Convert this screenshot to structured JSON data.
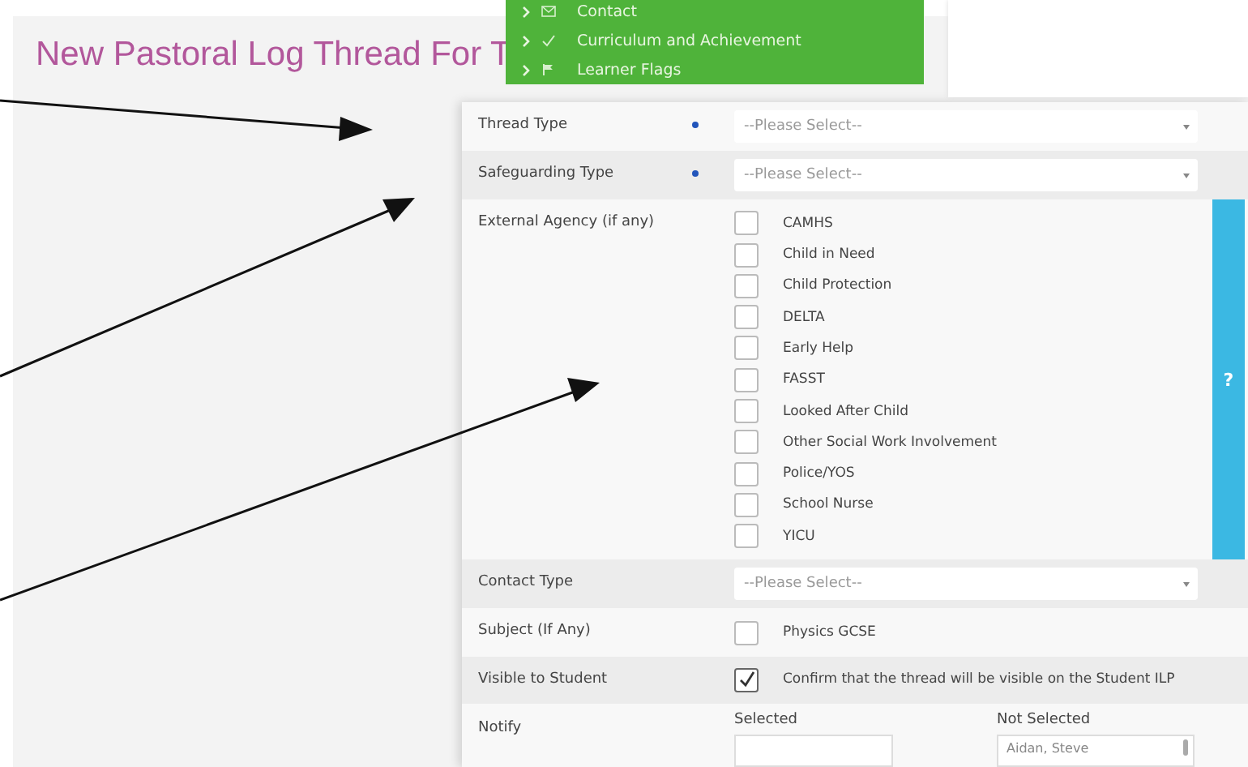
{
  "page_title": "New Pastoral Log Thread For T",
  "menu": {
    "items": [
      {
        "kind": "envelope",
        "label": "Contact"
      },
      {
        "kind": "check",
        "label": "Curriculum and Achievement"
      },
      {
        "kind": "flag",
        "label": "Learner Flags"
      }
    ]
  },
  "form": {
    "rows": [
      {
        "kind": "select",
        "label": "Thread Type",
        "required": true,
        "placeholder": "--Please Select--"
      },
      {
        "kind": "select",
        "label": "Safeguarding Type",
        "required": true,
        "placeholder": "--Please Select--"
      },
      {
        "kind": "checklist",
        "label": "External Agency (if any)",
        "options": [
          {
            "label": "CAMHS",
            "checked": false
          },
          {
            "label": "Child in Need",
            "checked": false
          },
          {
            "label": "Child Protection",
            "checked": false
          },
          {
            "label": "DELTA",
            "checked": false
          },
          {
            "label": "Early Help",
            "checked": false
          },
          {
            "label": "FASST",
            "checked": false
          },
          {
            "label": "Looked After Child",
            "checked": false
          },
          {
            "label": "Other Social Work Involvement",
            "checked": false
          },
          {
            "label": "Police/YOS",
            "checked": false
          },
          {
            "label": "School Nurse",
            "checked": false
          },
          {
            "label": "YICU",
            "checked": false
          }
        ]
      },
      {
        "kind": "select",
        "label": "Contact Type",
        "required": false,
        "placeholder": "--Please Select--"
      },
      {
        "kind": "checklist",
        "label": "Subject (If Any)",
        "options": [
          {
            "label": "Physics GCSE",
            "checked": false
          }
        ]
      },
      {
        "kind": "checklist",
        "label": "Visible to Student",
        "options": [
          {
            "label": "Confirm that the thread will be visible on the Student ILP",
            "checked": true
          }
        ]
      },
      {
        "kind": "notify",
        "label": "Notify",
        "selected_heading": "Selected",
        "not_selected_heading": "Not Selected",
        "not_selected_items": [
          "Aidan, Steve"
        ]
      }
    ]
  },
  "help_tab": "?"
}
